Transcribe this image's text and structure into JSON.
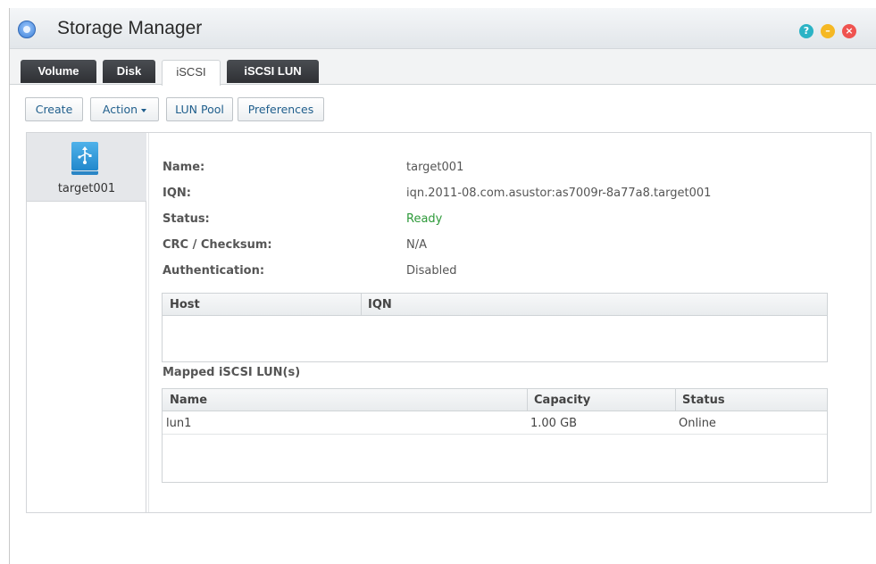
{
  "window": {
    "title": "Storage Manager",
    "help_glyph": "?",
    "minimize_glyph": "–",
    "close_glyph": "×"
  },
  "tabs": [
    {
      "label": "Volume",
      "active": false
    },
    {
      "label": "Disk",
      "active": false
    },
    {
      "label": "iSCSI",
      "active": true
    },
    {
      "label": "iSCSI LUN",
      "active": false
    }
  ],
  "toolbar": {
    "create": "Create",
    "action": "Action",
    "lun_pool": "LUN Pool",
    "preferences": "Preferences"
  },
  "targets": [
    {
      "name": "target001",
      "icon": "iscsi-target-icon"
    }
  ],
  "details": {
    "name_label": "Name:",
    "name_value": "target001",
    "iqn_label": "IQN:",
    "iqn_value": "iqn.2011-08.com.asustor:as7009r-8a77a8.target001",
    "status_label": "Status:",
    "status_value": "Ready",
    "crc_label": "CRC / Checksum:",
    "crc_value": "N/A",
    "auth_label": "Authentication:",
    "auth_value": "Disabled"
  },
  "hosts_table": {
    "columns": [
      "Host",
      "IQN"
    ],
    "rows": []
  },
  "luns_section": {
    "title": "Mapped iSCSI LUN(s)",
    "columns": [
      "Name",
      "Capacity",
      "Status"
    ],
    "rows": [
      {
        "name": "lun1",
        "capacity": "1.00 GB",
        "status": "Online"
      }
    ]
  },
  "colors": {
    "ready": "#2e9a3a",
    "tab_dark": "#2e3034",
    "link_blue": "#1f5e8c"
  }
}
